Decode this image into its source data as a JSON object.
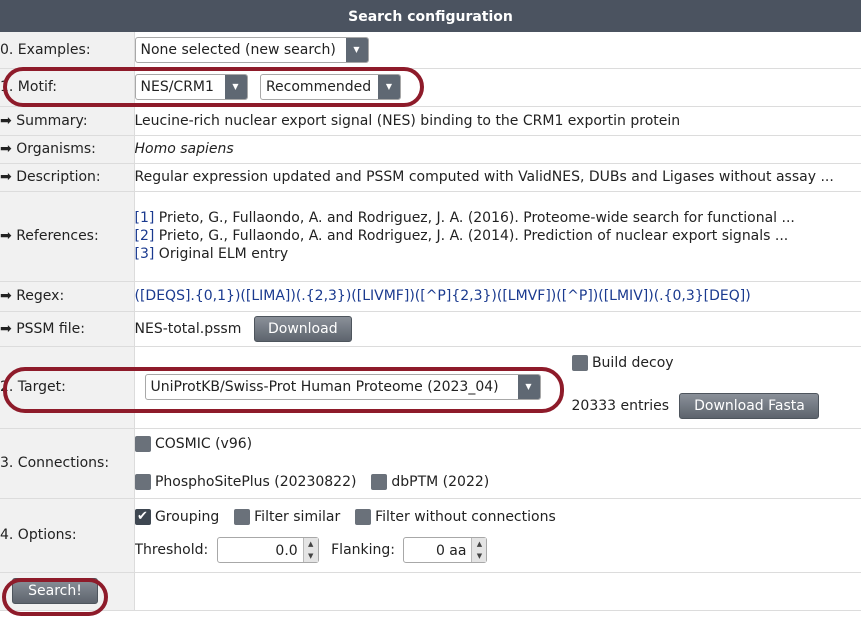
{
  "header": {
    "title": "Search configuration"
  },
  "rows": {
    "examples": {
      "label": "0. Examples:",
      "select_value": "None selected (new search)"
    },
    "motif": {
      "label": "1. Motif:",
      "motif_value": "NES/CRM1",
      "set_value": "Recommended"
    },
    "summary": {
      "arrow": "➡",
      "label": "Summary:",
      "value": "Leucine-rich nuclear export signal (NES) binding to the CRM1 exportin protein"
    },
    "organisms": {
      "arrow": "➡",
      "label": "Organisms:",
      "value": "Homo sapiens"
    },
    "description": {
      "arrow": "➡",
      "label": "Description:",
      "value": "Regular expression updated and PSSM computed with ValidNES, DUBs and Ligases without assay ..."
    },
    "references": {
      "arrow": "➡",
      "label": "References:",
      "items": [
        {
          "num": "[1]",
          "text": "Prieto, G., Fullaondo, A. and Rodriguez, J. A. (2016). Proteome-wide search for functional ..."
        },
        {
          "num": "[2]",
          "text": "Prieto, G., Fullaondo, A. and Rodriguez, J. A. (2014). Prediction of nuclear export signals ..."
        },
        {
          "num": "[3]",
          "text": "Original ELM entry"
        }
      ]
    },
    "regex": {
      "arrow": "➡",
      "label": "Regex:",
      "value": "([DEQS].{0,1})([LIMA])(.{2,3})([LIVMF])([^P]{2,3})([LMVF])([^P])([LMIV])(.{0,3}[DEQ])"
    },
    "pssm": {
      "arrow": "➡",
      "label": "PSSM file:",
      "file": "NES-total.pssm",
      "button": "Download"
    },
    "target": {
      "label": "2. Target:",
      "select_value": "UniProtKB/Swiss-Prot Human Proteome (2023_04)",
      "decoy_label": "Build decoy",
      "entries": "20333 entries",
      "download_button": "Download Fasta"
    },
    "connections": {
      "label": "3. Connections:",
      "cosmic": "COSMIC (v96)",
      "phospho": "PhosphoSitePlus (20230822)",
      "dbptm": "dbPTM (2022)"
    },
    "options": {
      "label": "4. Options:",
      "grouping": "Grouping",
      "filter_similar": "Filter similar",
      "filter_conn": "Filter without connections",
      "threshold_label": "Threshold:",
      "threshold_value": "0.0",
      "flanking_label": "Flanking:",
      "flanking_value": "0 aa"
    },
    "search": {
      "button": "Search!"
    }
  },
  "colors": {
    "header_bg": "#4b5360",
    "highlight_ring": "#8e1b2a",
    "link": "#1a3a8f"
  }
}
